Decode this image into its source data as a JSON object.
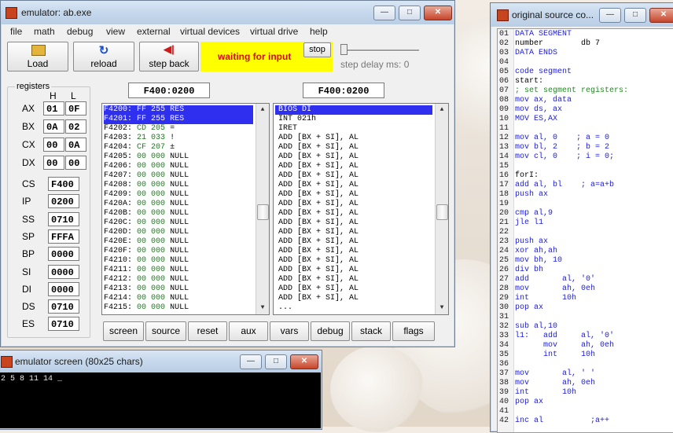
{
  "emulator": {
    "title": "emulator: ab.exe",
    "menu": [
      "file",
      "math",
      "debug",
      "view",
      "external",
      "virtual devices",
      "virtual drive",
      "help"
    ],
    "toolbar": {
      "load": "Load",
      "reload": "reload",
      "step_back": "step back",
      "status": "waiting for input",
      "stop": "stop",
      "step_delay": "step delay ms: 0"
    },
    "registers_title": "registers",
    "col_h": "H",
    "col_l": "L",
    "regs_split": [
      {
        "name": "AX",
        "h": "01",
        "l": "0F"
      },
      {
        "name": "BX",
        "h": "0A",
        "l": "02"
      },
      {
        "name": "CX",
        "h": "00",
        "l": "0A"
      },
      {
        "name": "DX",
        "h": "00",
        "l": "00"
      }
    ],
    "regs_full": [
      {
        "name": "CS",
        "v": "F400"
      },
      {
        "name": "IP",
        "v": "0200"
      },
      {
        "name": "SS",
        "v": "0710"
      },
      {
        "name": "SP",
        "v": "FFFA"
      },
      {
        "name": "BP",
        "v": "0000"
      },
      {
        "name": "SI",
        "v": "0000"
      },
      {
        "name": "DI",
        "v": "0000"
      },
      {
        "name": "DS",
        "v": "0710"
      },
      {
        "name": "ES",
        "v": "0710"
      }
    ],
    "addr_left": "F400:0200",
    "addr_right": "F400:0200",
    "memory_rows": [
      {
        "addr": "F4200:",
        "hex": "FF 255",
        "sym": "RES",
        "sel": true
      },
      {
        "addr": "F4201:",
        "hex": "FF 255",
        "sym": "RES",
        "sel": true
      },
      {
        "addr": "F4202:",
        "hex": "CD 205",
        "sym": "="
      },
      {
        "addr": "F4203:",
        "hex": "21 033",
        "sym": "!"
      },
      {
        "addr": "F4204:",
        "hex": "CF 207",
        "sym": "±"
      },
      {
        "addr": "F4205:",
        "hex": "00 000",
        "sym": "NULL"
      },
      {
        "addr": "F4206:",
        "hex": "00 000",
        "sym": "NULL"
      },
      {
        "addr": "F4207:",
        "hex": "00 000",
        "sym": "NULL"
      },
      {
        "addr": "F4208:",
        "hex": "00 000",
        "sym": "NULL"
      },
      {
        "addr": "F4209:",
        "hex": "00 000",
        "sym": "NULL"
      },
      {
        "addr": "F420A:",
        "hex": "00 000",
        "sym": "NULL"
      },
      {
        "addr": "F420B:",
        "hex": "00 000",
        "sym": "NULL"
      },
      {
        "addr": "F420C:",
        "hex": "00 000",
        "sym": "NULL"
      },
      {
        "addr": "F420D:",
        "hex": "00 000",
        "sym": "NULL"
      },
      {
        "addr": "F420E:",
        "hex": "00 000",
        "sym": "NULL"
      },
      {
        "addr": "F420F:",
        "hex": "00 000",
        "sym": "NULL"
      },
      {
        "addr": "F4210:",
        "hex": "00 000",
        "sym": "NULL"
      },
      {
        "addr": "F4211:",
        "hex": "00 000",
        "sym": "NULL"
      },
      {
        "addr": "F4212:",
        "hex": "00 000",
        "sym": "NULL"
      },
      {
        "addr": "F4213:",
        "hex": "00 000",
        "sym": "NULL"
      },
      {
        "addr": "F4214:",
        "hex": "00 000",
        "sym": "NULL"
      },
      {
        "addr": "F4215:",
        "hex": "00 000",
        "sym": "NULL"
      }
    ],
    "disasm_rows": [
      {
        "text": "BIOS DI",
        "sel": true
      },
      {
        "text": "INT 021h"
      },
      {
        "text": "IRET"
      },
      {
        "text": "ADD [BX + SI], AL"
      },
      {
        "text": "ADD [BX + SI], AL"
      },
      {
        "text": "ADD [BX + SI], AL"
      },
      {
        "text": "ADD [BX + SI], AL"
      },
      {
        "text": "ADD [BX + SI], AL"
      },
      {
        "text": "ADD [BX + SI], AL"
      },
      {
        "text": "ADD [BX + SI], AL"
      },
      {
        "text": "ADD [BX + SI], AL"
      },
      {
        "text": "ADD [BX + SI], AL"
      },
      {
        "text": "ADD [BX + SI], AL"
      },
      {
        "text": "ADD [BX + SI], AL"
      },
      {
        "text": "ADD [BX + SI], AL"
      },
      {
        "text": "ADD [BX + SI], AL"
      },
      {
        "text": "ADD [BX + SI], AL"
      },
      {
        "text": "ADD [BX + SI], AL"
      },
      {
        "text": "ADD [BX + SI], AL"
      },
      {
        "text": "ADD [BX + SI], AL"
      },
      {
        "text": "ADD [BX + SI], AL"
      },
      {
        "text": "..."
      }
    ],
    "bottom_buttons": [
      "screen",
      "source",
      "reset",
      "aux",
      "vars",
      "debug",
      "stack",
      "flags"
    ]
  },
  "screen_window": {
    "title": "emulator screen (80x25 chars)",
    "output": "2 5 8 11 14 _"
  },
  "source_window": {
    "title": "original source co...",
    "lines": [
      {
        "n": "01",
        "t": "DATA SEGMENT",
        "c": "kw"
      },
      {
        "n": "02",
        "t": "number        db 7",
        "c": ""
      },
      {
        "n": "03",
        "t": "DATA ENDS",
        "c": "kw"
      },
      {
        "n": "04",
        "t": "",
        "c": ""
      },
      {
        "n": "05",
        "t": "code segment",
        "c": "kw"
      },
      {
        "n": "06",
        "t": "start:",
        "c": ""
      },
      {
        "n": "07",
        "t": "; set segment registers:",
        "c": "cm"
      },
      {
        "n": "08",
        "t": "mov ax, data",
        "c": "kw"
      },
      {
        "n": "09",
        "t": "mov ds, ax",
        "c": "kw"
      },
      {
        "n": "10",
        "t": "MOV ES,AX",
        "c": "kw"
      },
      {
        "n": "11",
        "t": "",
        "c": ""
      },
      {
        "n": "12",
        "t": "mov al, 0    ; a = 0",
        "c": "kw"
      },
      {
        "n": "13",
        "t": "mov bl, 2    ; b = 2",
        "c": "kw"
      },
      {
        "n": "14",
        "t": "mov cl, 0    ; i = 0;",
        "c": "kw"
      },
      {
        "n": "15",
        "t": "",
        "c": ""
      },
      {
        "n": "16",
        "t": "forI:",
        "c": ""
      },
      {
        "n": "17",
        "t": "add al, bl    ; a=a+b",
        "c": "kw"
      },
      {
        "n": "18",
        "t": "push ax",
        "c": "kw"
      },
      {
        "n": "19",
        "t": "",
        "c": ""
      },
      {
        "n": "20",
        "t": "cmp al,9",
        "c": "kw"
      },
      {
        "n": "21",
        "t": "jle l1",
        "c": "kw"
      },
      {
        "n": "22",
        "t": "",
        "c": ""
      },
      {
        "n": "23",
        "t": "push ax",
        "c": "kw"
      },
      {
        "n": "24",
        "t": "xor ah,ah",
        "c": "kw"
      },
      {
        "n": "25",
        "t": "mov bh, 10",
        "c": "kw"
      },
      {
        "n": "26",
        "t": "div bh",
        "c": "kw"
      },
      {
        "n": "27",
        "t": "add       al, '0'",
        "c": "kw"
      },
      {
        "n": "28",
        "t": "mov       ah, 0eh",
        "c": "kw"
      },
      {
        "n": "29",
        "t": "int       10h",
        "c": "kw"
      },
      {
        "n": "30",
        "t": "pop ax",
        "c": "kw"
      },
      {
        "n": "31",
        "t": "",
        "c": ""
      },
      {
        "n": "32",
        "t": "sub al,10",
        "c": "kw"
      },
      {
        "n": "33",
        "t": "l1:   add     al, '0'",
        "c": "kw"
      },
      {
        "n": "34",
        "t": "      mov     ah, 0eh",
        "c": "kw"
      },
      {
        "n": "35",
        "t": "      int     10h",
        "c": "kw"
      },
      {
        "n": "36",
        "t": "",
        "c": ""
      },
      {
        "n": "37",
        "t": "mov       al, ' '",
        "c": "kw"
      },
      {
        "n": "38",
        "t": "mov       ah, 0eh",
        "c": "kw"
      },
      {
        "n": "39",
        "t": "int       10h",
        "c": "kw"
      },
      {
        "n": "40",
        "t": "pop ax",
        "c": "kw"
      },
      {
        "n": "41",
        "t": "",
        "c": ""
      },
      {
        "n": "42",
        "t": "inc al          ;a++",
        "c": "kw"
      }
    ]
  },
  "colors": {
    "selection": "#2f2ff0",
    "status_bg": "#ffff00",
    "status_fg": "#d01010",
    "keyword": "#2020d8",
    "comment": "#1e8a1e"
  }
}
